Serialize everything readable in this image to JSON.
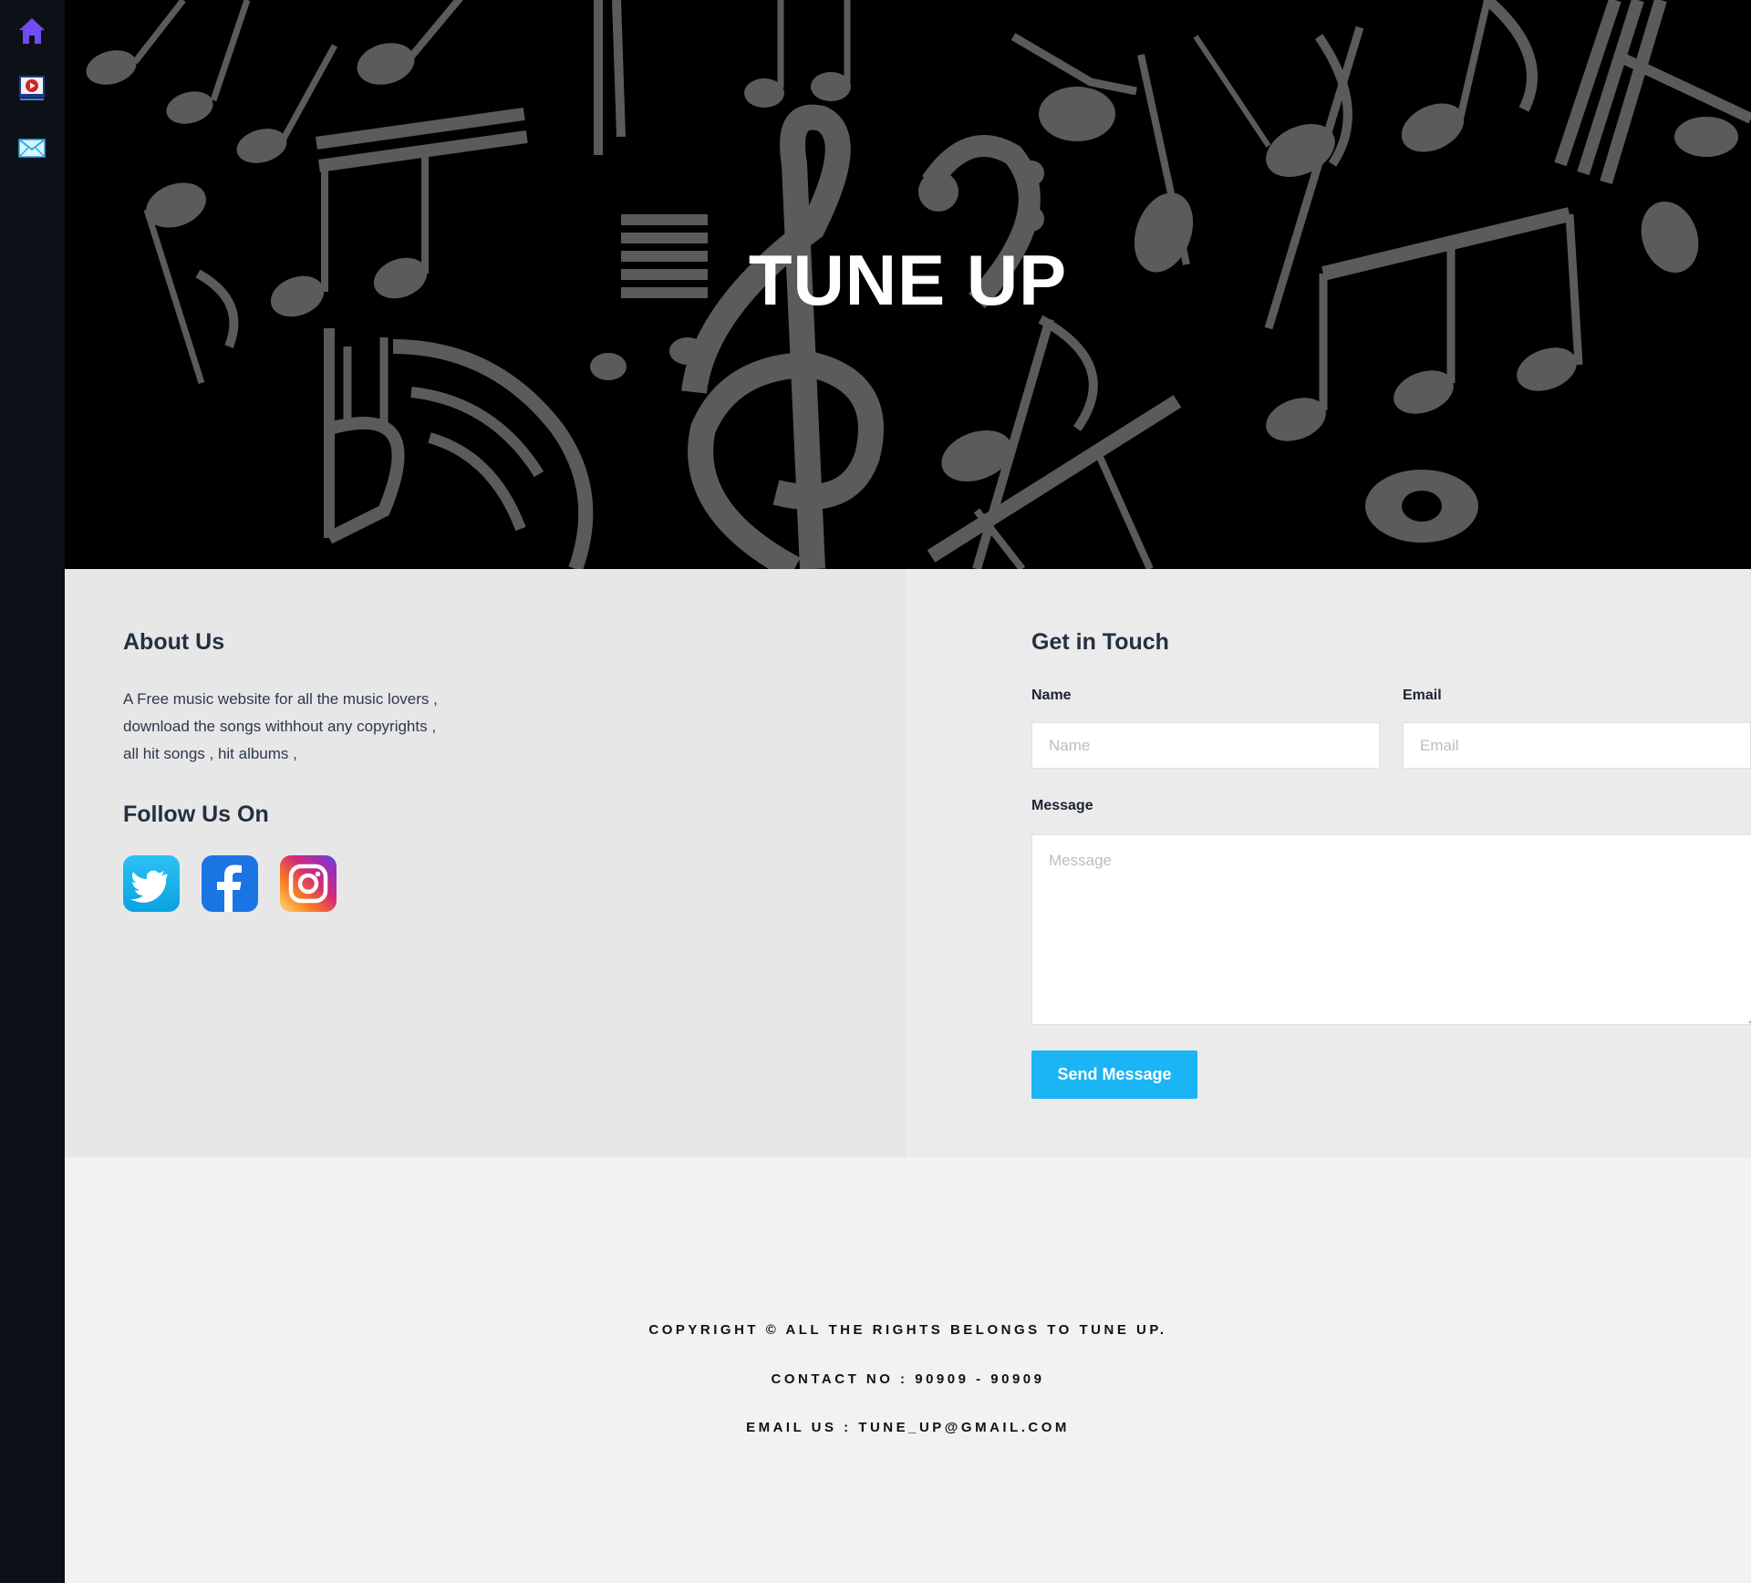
{
  "sidebar": {
    "items": [
      {
        "icon": "home-icon",
        "label": "Home"
      },
      {
        "icon": "video-icon",
        "label": "Videos"
      },
      {
        "icon": "mail-icon",
        "label": "Contact"
      }
    ]
  },
  "hero": {
    "title": "TUNE UP"
  },
  "about": {
    "heading": "About Us",
    "lines": [
      "A Free music website for all the music lovers ,",
      "download the songs withhout any copyrights ,",
      "all hit songs , hit albums ,"
    ],
    "follow_heading": "Follow Us On",
    "social": [
      {
        "icon": "twitter-icon",
        "color": "#1da1f2"
      },
      {
        "icon": "facebook-icon",
        "color": "#1877f2"
      },
      {
        "icon": "instagram-icon",
        "color": "#e1306c"
      }
    ]
  },
  "contact": {
    "heading": "Get in Touch",
    "name_label": "Name",
    "name_placeholder": "Name",
    "email_label": "Email",
    "email_placeholder": "Email",
    "message_label": "Message",
    "message_placeholder": "Message",
    "send_label": "Send Message"
  },
  "footer": {
    "copyright": "COPYRIGHT © ALL THE RIGHTS BELONGS TO TUNE UP.",
    "contact": "CONTACT NO : 90909 - 90909",
    "email": "EMAIL US : TUNE_UP@GMAIL.COM"
  },
  "colors": {
    "accent": "#1bb4f4",
    "sidebar": "#0d1117",
    "home_icon": "#6f4cf3"
  }
}
